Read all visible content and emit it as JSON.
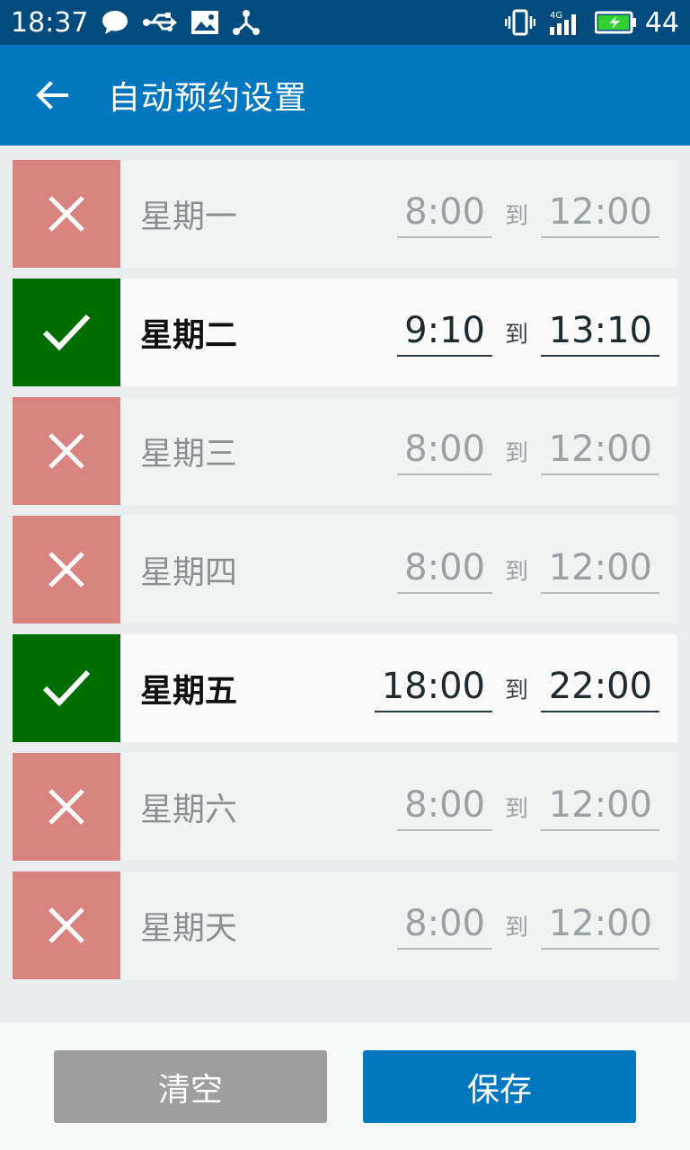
{
  "status_bar": {
    "time": "18:37",
    "battery_level": "44",
    "left_icons": [
      "chat-icon",
      "usb-icon",
      "image-icon",
      "share-icon"
    ],
    "right_icons": [
      "vibrate-icon",
      "signal-4g-icon",
      "battery-charging-icon"
    ]
  },
  "app_bar": {
    "title": "自动预约设置",
    "back_icon": "arrow-left-icon"
  },
  "schedule": [
    {
      "day": "星期一",
      "enabled": false,
      "start": "8:00",
      "to": "到",
      "end": "12:00"
    },
    {
      "day": "星期二",
      "enabled": true,
      "start": "9:10",
      "to": "到",
      "end": "13:10"
    },
    {
      "day": "星期三",
      "enabled": false,
      "start": "8:00",
      "to": "到",
      "end": "12:00"
    },
    {
      "day": "星期四",
      "enabled": false,
      "start": "8:00",
      "to": "到",
      "end": "12:00"
    },
    {
      "day": "星期五",
      "enabled": true,
      "start": "18:00",
      "to": "到",
      "end": "22:00"
    },
    {
      "day": "星期六",
      "enabled": false,
      "start": "8:00",
      "to": "到",
      "end": "12:00"
    },
    {
      "day": "星期天",
      "enabled": false,
      "start": "8:00",
      "to": "到",
      "end": "12:00"
    }
  ],
  "footer": {
    "clear_label": "清空",
    "save_label": "保存"
  },
  "colors": {
    "status_bar": "#014b7e",
    "app_bar": "#0177bf",
    "enabled_toggle": "#006d00",
    "disabled_toggle": "#d98381",
    "clear_button": "#9e9e9e",
    "save_button": "#0177bf"
  }
}
